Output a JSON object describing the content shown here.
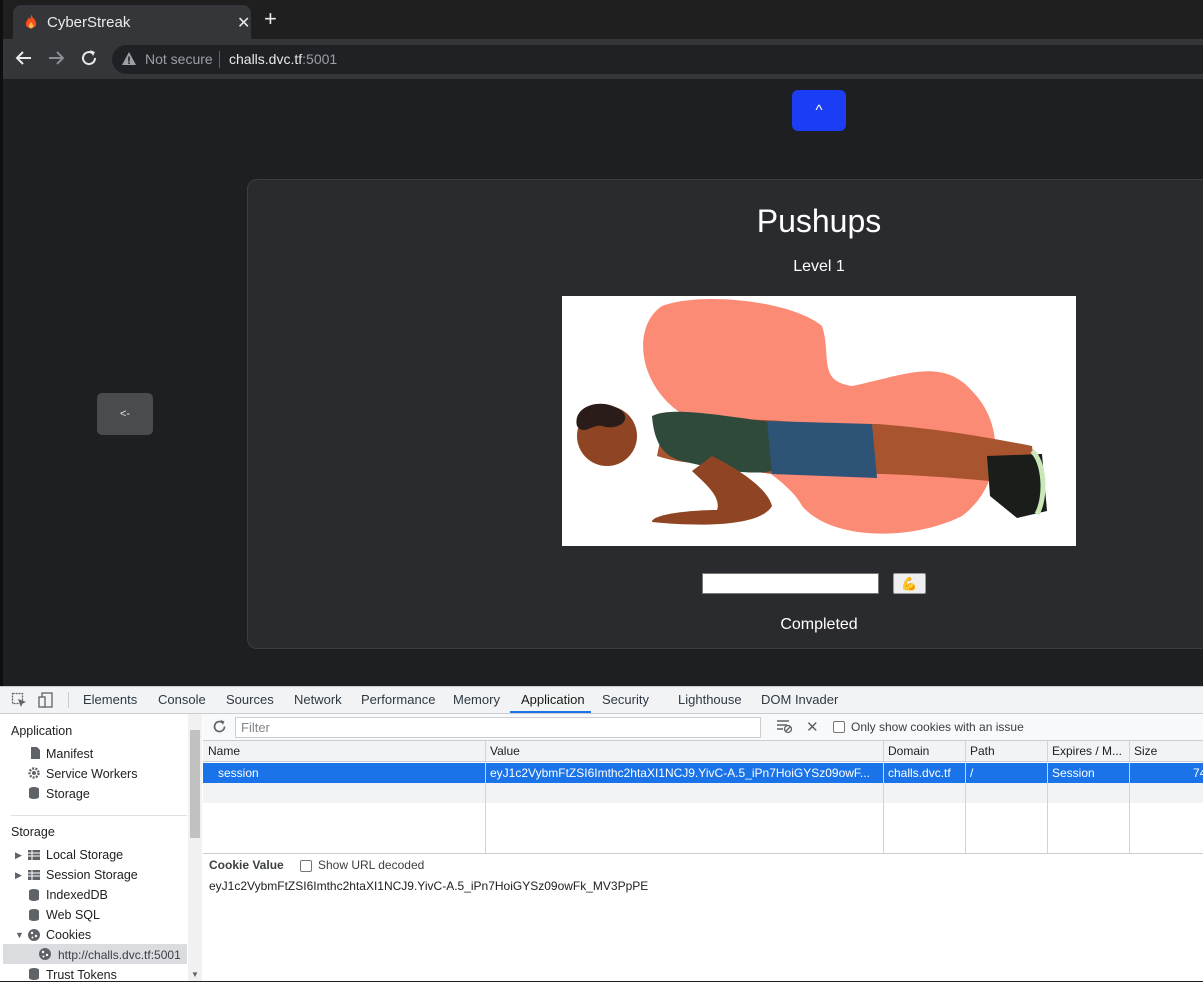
{
  "browser": {
    "tab_title": "CyberStreak",
    "tab_close": "✕",
    "new_tab": "+",
    "security_label": "Not secure",
    "url_host": "challs.dvc.tf",
    "url_port": ":5001",
    "icons": [
      "fire-favicon-icon",
      "back-arrow-icon",
      "forward-arrow-icon",
      "reload-icon",
      "warning-icon"
    ]
  },
  "page": {
    "up_button": "^",
    "back_button": "<-",
    "title": "Pushups",
    "level": "Level 1",
    "submit_emoji": "💪",
    "status": "Completed",
    "colors": {
      "up_button": "#1a3df5",
      "card": "#2a2b2e",
      "background": "#1e1f22"
    }
  },
  "devtools": {
    "tabs": [
      "Elements",
      "Console",
      "Sources",
      "Network",
      "Performance",
      "Memory",
      "Application",
      "Security",
      "Lighthouse",
      "DOM Invader"
    ],
    "active_tab": "Application",
    "sidebar": {
      "application_header": "Application",
      "application_items": [
        "Manifest",
        "Service Workers",
        "Storage"
      ],
      "storage_header": "Storage",
      "storage_items": [
        "Local Storage",
        "Session Storage",
        "IndexedDB",
        "Web SQL",
        "Cookies"
      ],
      "cookie_origin": "http://challs.dvc.tf:5001",
      "trust_tokens": "Trust Tokens"
    },
    "filter_placeholder": "Filter",
    "only_issue_label": "Only show cookies with an issue",
    "columns": [
      "Name",
      "Value",
      "Domain",
      "Path",
      "Expires / M...",
      "Size"
    ],
    "rows": [
      {
        "name": "session",
        "value": "eyJ1c2VybmFtZSI6Imthc2htaXI1NCJ9.YivC-A.5_iPn7HoiGYSz09owF...",
        "domain": "challs.dvc.tf",
        "path": "/",
        "expires": "Session",
        "size": "74"
      }
    ],
    "cookie_value_title": "Cookie Value",
    "show_url_decoded": "Show URL decoded",
    "cookie_value": "eyJ1c2VybmFtZSI6Imthc2htaXI1NCJ9.YivC-A.5_iPn7HoiGYSz09owFk_MV3PpPE"
  }
}
